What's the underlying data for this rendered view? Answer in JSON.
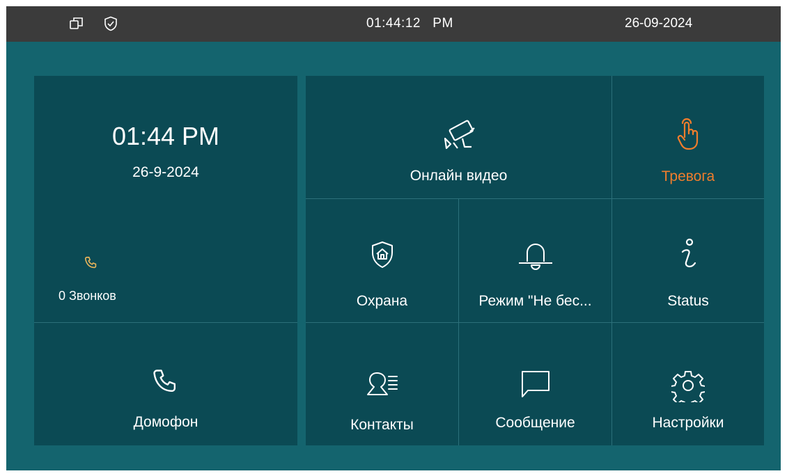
{
  "statusbar": {
    "time": "01:44:12   PM",
    "date": "26-09-2024",
    "icons": [
      "windows-icon",
      "shield-check-icon"
    ]
  },
  "clock": {
    "time": "01:44 PM",
    "date": "26-9-2024",
    "calls_label": "0 Звонков",
    "calls_icon": "phone-icon"
  },
  "tiles": {
    "intercom": {
      "label": "Домофон",
      "icon": "phone-icon"
    },
    "online_video": {
      "label": "Онлайн видео",
      "icon": "cctv-camera-icon"
    },
    "alarm": {
      "label": "Тревога",
      "icon": "hand-tap-icon",
      "color": "#f07d2c"
    },
    "security": {
      "label": "Охрана",
      "icon": "home-shield-icon"
    },
    "dnd": {
      "label": "Режим \"Не бес...",
      "icon": "bell-icon"
    },
    "status": {
      "label": "Status",
      "icon": "info-icon"
    },
    "contacts": {
      "label": "Контакты",
      "icon": "contacts-icon"
    },
    "messages": {
      "label": "Сообщение",
      "icon": "message-icon"
    },
    "settings": {
      "label": "Настройки",
      "icon": "gear-icon"
    }
  },
  "colors": {
    "background": "#14646e",
    "panel": "#0b4a54",
    "statusbar": "#3b3b3b",
    "accent_orange": "#f07d2c",
    "call_icon": "#e8b45a"
  }
}
